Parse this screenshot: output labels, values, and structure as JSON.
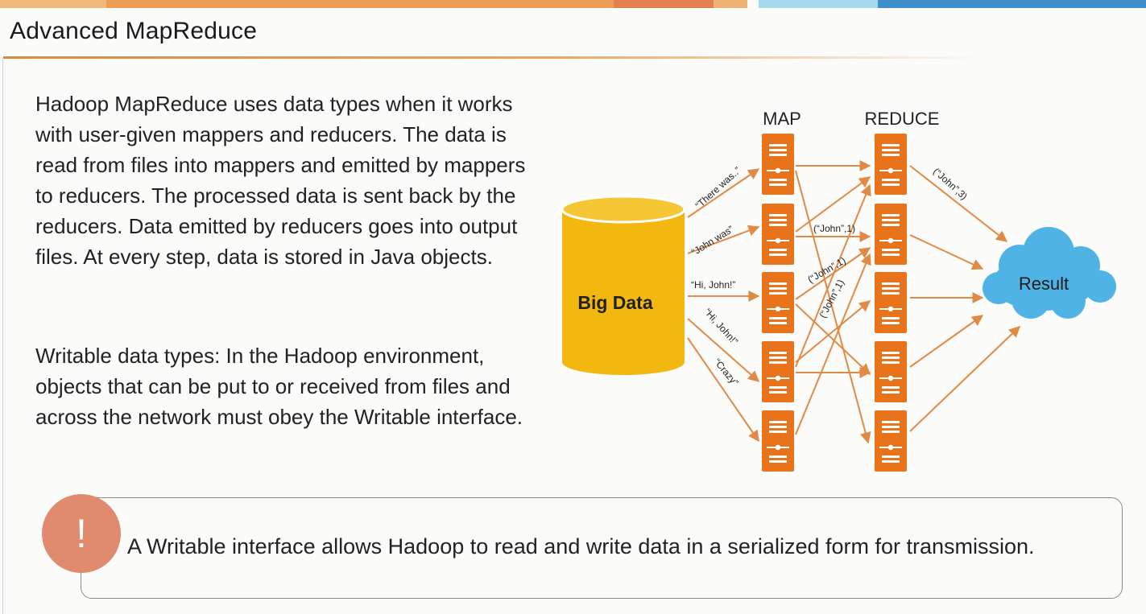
{
  "slide": {
    "title": "Advanced MapReduce",
    "paragraph1": "Hadoop MapReduce uses data types when it works with user-given mappers and reducers. The data is read from files into mappers and emitted by mappers to reducers. The processed data is sent back by the reducers. Data emitted by reducers goes into output files. At every step, data is stored in Java objects.",
    "paragraph2": "Writable data types: In the Hadoop environment, objects that can be put to or received from files and across the network must obey the Writable interface.",
    "note": {
      "icon_symbol": "!",
      "text": "A Writable interface allows Hadoop to read and write data in a serialized form for transmission."
    }
  },
  "diagram": {
    "map_header": "MAP",
    "reduce_header": "REDUCE",
    "source_label": "Big Data",
    "result_label": "Result",
    "input_labels": [
      "“There was..”",
      "“John was”",
      "“Hi, John!”",
      "“Hi, John!”",
      "“Crazy”"
    ],
    "intermediate_labels": [
      "(“John”,1)",
      "(“John”,1)",
      "(“John”,1)"
    ],
    "output_label": "(“John”,3)",
    "colors": {
      "server": "#e8731a",
      "arrow": "#e08a45",
      "cylinder": "#f2b810",
      "cloud": "#4fb3e6"
    }
  },
  "theme": {
    "topbar_colors": [
      "#f2b879",
      "#ef9f55",
      "#e6814f",
      "#f1b275",
      "#a7d7ee",
      "#3e8fc8"
    ]
  }
}
